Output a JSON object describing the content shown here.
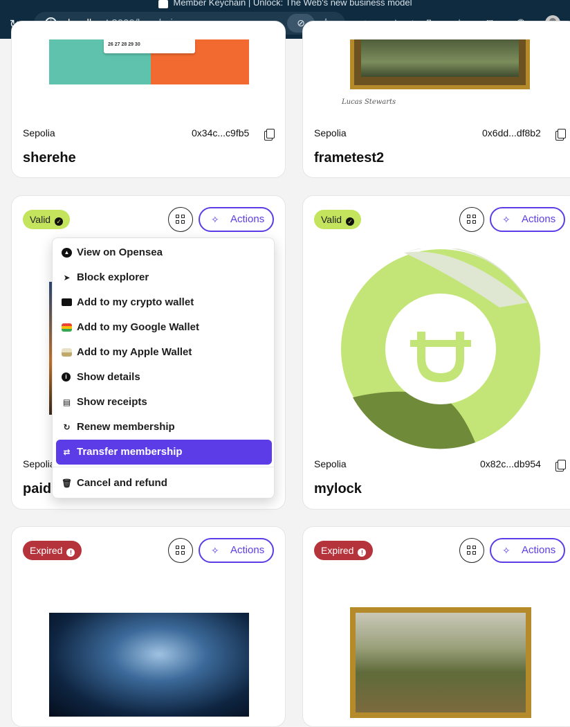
{
  "browser": {
    "tab_title": "Member Keychain | Unlock: The Web's new business model",
    "url_host": "localhost",
    "url_rest": ":3000/keychain"
  },
  "cards": [
    {
      "network": "Sepolia",
      "address": "0x34c...c9fb5",
      "name": "sherehe",
      "calendar_days": "26  27  28  29  30"
    },
    {
      "network": "Sepolia",
      "address": "0x6dd...df8b2",
      "name": "frametest2",
      "signature": "Lucas Stewarts"
    },
    {
      "status": "Valid",
      "network": "Sepolia",
      "name": "paid",
      "actions_label": "Actions"
    },
    {
      "status": "Valid",
      "network": "Sepolia",
      "address": "0x82c...db954",
      "name": "mylock",
      "actions_label": "Actions"
    },
    {
      "status": "Expired",
      "actions_label": "Actions"
    },
    {
      "status": "Expired",
      "actions_label": "Actions"
    }
  ],
  "menu": {
    "items": [
      {
        "label": "View on Opensea",
        "icon": "opensea-icon"
      },
      {
        "label": "Block explorer",
        "icon": "cursor-icon"
      },
      {
        "label": "Add to my crypto wallet",
        "icon": "wallet-icon"
      },
      {
        "label": "Add to my Google Wallet",
        "icon": "google-wallet-icon"
      },
      {
        "label": "Add to my Apple Wallet",
        "icon": "apple-wallet-icon"
      },
      {
        "label": "Show details",
        "icon": "info-icon"
      },
      {
        "label": "Show receipts",
        "icon": "receipt-icon"
      },
      {
        "label": "Renew membership",
        "icon": "renew-icon"
      },
      {
        "label": "Transfer membership",
        "icon": "transfer-icon"
      },
      {
        "label": "Cancel and refund",
        "icon": "trash-icon"
      }
    ]
  },
  "colors": {
    "accent": "#5b3ce6",
    "valid": "#c3e45c",
    "expired": "#b5343c",
    "lock_green": "#c3e577",
    "lock_dark": "#6f8a39"
  }
}
